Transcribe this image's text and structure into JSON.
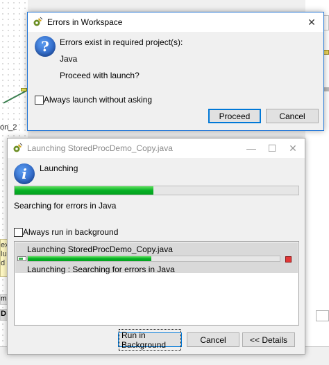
{
  "background": {
    "node_label": "on_2",
    "note_lines": [
      "ex",
      "lu",
      "d"
    ],
    "tab_1": "m",
    "tab_2": "D"
  },
  "errors_dialog": {
    "title": "Errors in Workspace",
    "icon": "question-icon",
    "message": "Errors exist in required project(s):",
    "project": "Java",
    "question": "Proceed with launch?",
    "checkbox_label": "Always launch without asking",
    "checkbox_checked": false,
    "proceed_label": "Proceed",
    "cancel_label": "Cancel",
    "close_glyph": "✕"
  },
  "launch_dialog": {
    "title": "Launching StoredProcDemo_Copy.java",
    "icon": "info-icon",
    "heading": "Launching",
    "progress_fraction": 0.49,
    "status": "Searching for errors in Java",
    "checkbox_label": "Always run in background",
    "checkbox_checked": false,
    "task": {
      "name": "Launching StoredProcDemo_Copy.java",
      "progress_fraction": 0.49,
      "detail": "Launching : Searching for errors in Java"
    },
    "run_bg_label": "Run in Background",
    "cancel_label": "Cancel",
    "details_label": "<< Details",
    "min_glyph": "—",
    "max_glyph": "☐",
    "close_glyph": "✕"
  },
  "colors": {
    "accent": "#0078d7",
    "progress_green": "#06b025",
    "stop_red": "#e23636"
  }
}
